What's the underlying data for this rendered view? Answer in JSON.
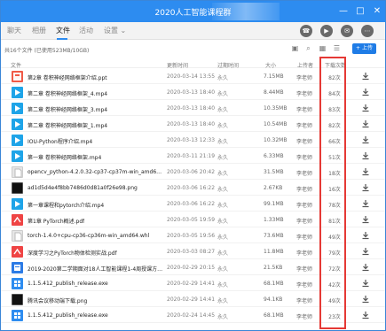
{
  "window": {
    "title": "2020人工智能课程群",
    "buttons": [
      "—",
      "□",
      "✕"
    ]
  },
  "tabs": [
    {
      "label": "聊天",
      "active": false
    },
    {
      "label": "相册",
      "active": false
    },
    {
      "label": "文件",
      "active": true
    },
    {
      "label": "活动",
      "active": false
    },
    {
      "label": "设置 ⌄",
      "active": false
    }
  ],
  "toolbar": {
    "summary": "共16个文件 (已使用523MB/10GB)",
    "upload_label": "+ 上传",
    "icons": [
      "phone-icon",
      "video-icon",
      "chat-icon",
      "more-icon"
    ],
    "file_icons": [
      "folder-icon",
      "search-icon",
      "grid-icon",
      "list-icon"
    ]
  },
  "table": {
    "headers": [
      "文件",
      "更新时间",
      "过期时间",
      "大小",
      "上传者",
      "下载次数"
    ],
    "rows": [
      {
        "name": "第2章 卷积神经网络框架介绍.ppt",
        "time": "2020-03-14 13:55",
        "expiry": "永久",
        "size": "7.15MB",
        "uploader": "李老师",
        "downloads": "82次",
        "kind": "ppt"
      },
      {
        "name": "第二章 卷积神经网络框架_4.mp4",
        "time": "2020-03-13 18:40",
        "expiry": "永久",
        "size": "8.44MB",
        "uploader": "李老师",
        "downloads": "84次",
        "kind": "mp4"
      },
      {
        "name": "第二章 卷积神经网络框架_3.mp4",
        "time": "2020-03-13 18:40",
        "expiry": "永久",
        "size": "10.35MB",
        "uploader": "李老师",
        "downloads": "83次",
        "kind": "mp4"
      },
      {
        "name": "第二章 卷积神经网络框架_1.mp4",
        "time": "2020-03-13 18:40",
        "expiry": "永久",
        "size": "10.54MB",
        "uploader": "李老师",
        "downloads": "82次",
        "kind": "mp4"
      },
      {
        "name": "IOU-Python程序介绍.mp4",
        "time": "2020-03-13 12:33",
        "expiry": "永久",
        "size": "10.32MB",
        "uploader": "李老师",
        "downloads": "66次",
        "kind": "mp4"
      },
      {
        "name": "第一章 卷积神经网络框架.mp4",
        "time": "2020-03-11 21:19",
        "expiry": "永久",
        "size": "6.33MB",
        "uploader": "李老师",
        "downloads": "51次",
        "kind": "mp4"
      },
      {
        "name": "opencv_python-4.2.0.32-cp37-cp37m-win_amd64.whl",
        "time": "2020-03-06 20:42",
        "expiry": "永久",
        "size": "31.5MB",
        "uploader": "李老师",
        "downloads": "18次",
        "kind": "whl"
      },
      {
        "name": "ad1d5d4e4f8bb7486d0d81a0f26e98.png",
        "time": "2020-03-06 16:22",
        "expiry": "永久",
        "size": "2.67KB",
        "uploader": "李老师",
        "downloads": "16次",
        "kind": "png"
      },
      {
        "name": "第一章课程和pytorch介绍.mp4",
        "time": "2020-03-06 16:22",
        "expiry": "永久",
        "size": "99.1MB",
        "uploader": "李老师",
        "downloads": "78次",
        "kind": "mp4"
      },
      {
        "name": "第1章 PyTorch概述.pdf",
        "time": "2020-03-05 19:59",
        "expiry": "永久",
        "size": "1.33MB",
        "uploader": "李老师",
        "downloads": "81次",
        "kind": "pdf"
      },
      {
        "name": "torch-1.4.0+cpu-cp36-cp36m-win_amd64.whl",
        "time": "2020-03-05 19:56",
        "expiry": "永久",
        "size": "73.6MB",
        "uploader": "李老师",
        "downloads": "49次",
        "kind": "whl"
      },
      {
        "name": "深度学习之PyTorch物体检测实战.pdf",
        "time": "2020-03-03 08:27",
        "expiry": "永久",
        "size": "11.8MB",
        "uploader": "李老师",
        "downloads": "79次",
        "kind": "pdf"
      },
      {
        "name": "2019-2020第二学期面对18人工智能课程1-4周授课方案.doc",
        "time": "2020-02-29 20:15",
        "expiry": "永久",
        "size": "21.5KB",
        "uploader": "李老师",
        "downloads": "72次",
        "kind": "doc"
      },
      {
        "name": "1.1.5.412_publish_release.exe",
        "time": "2020-02-29 14:41",
        "expiry": "永久",
        "size": "68.1MB",
        "uploader": "李老师",
        "downloads": "42次",
        "kind": "exe"
      },
      {
        "name": "腾讯会议移动端下载.png",
        "time": "2020-02-29 14:41",
        "expiry": "永久",
        "size": "94.1KB",
        "uploader": "李老师",
        "downloads": "49次",
        "kind": "png"
      },
      {
        "name": "1.1.5.412_publish_release.exe",
        "time": "2020-02-24 14:45",
        "expiry": "永久",
        "size": "68.1MB",
        "uploader": "李老师",
        "downloads": "23次",
        "kind": "exe"
      }
    ]
  },
  "colors": {
    "accent": "#2d8cf0",
    "highlight": "#e53935",
    "ppt": "#f05a47",
    "mp4": "#1ea4e8",
    "pdf": "#ef4444",
    "doc": "#2c7be5",
    "exe": "#2d8cf0",
    "whl": "#e6e6e6",
    "png": "#111111"
  }
}
